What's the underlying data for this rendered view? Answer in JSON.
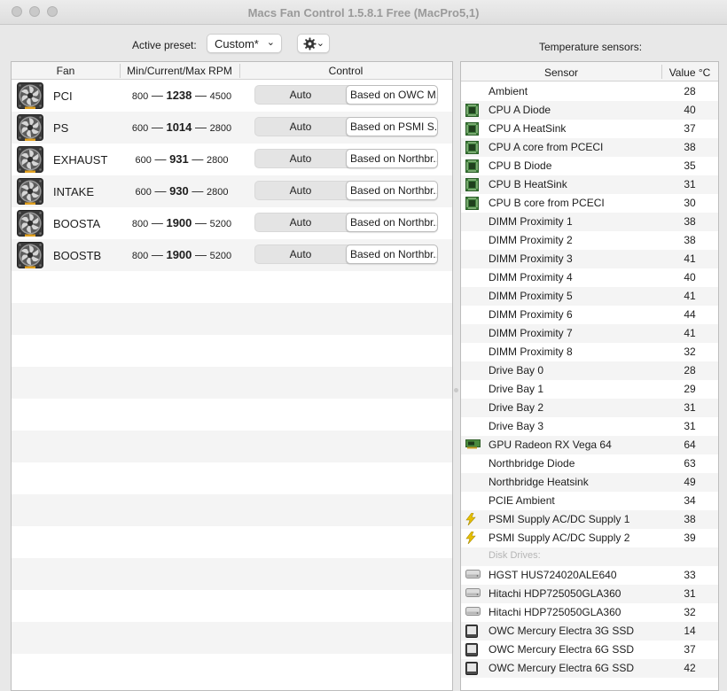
{
  "window": {
    "title": "Macs Fan Control 1.5.8.1 Free (MacPro5,1)"
  },
  "toolbar": {
    "preset_label": "Active preset:",
    "preset_value": "Custom*",
    "settings_icon": "gear-icon"
  },
  "temperature": {
    "title": "Temperature sensors:"
  },
  "fan_table": {
    "headers": {
      "fan": "Fan",
      "rpm": "Min/Current/Max RPM",
      "control": "Control"
    },
    "rows": [
      {
        "name": "PCI",
        "min": "800",
        "current": "1238",
        "max": "4500",
        "mode": "Auto",
        "source": "Based on OWC M..."
      },
      {
        "name": "PS",
        "min": "600",
        "current": "1014",
        "max": "2800",
        "mode": "Auto",
        "source": "Based on PSMI S..."
      },
      {
        "name": "EXHAUST",
        "min": "600",
        "current": "931",
        "max": "2800",
        "mode": "Auto",
        "source": "Based on Northbr..."
      },
      {
        "name": "INTAKE",
        "min": "600",
        "current": "930",
        "max": "2800",
        "mode": "Auto",
        "source": "Based on Northbr..."
      },
      {
        "name": "BOOSTA",
        "min": "800",
        "current": "1900",
        "max": "5200",
        "mode": "Auto",
        "source": "Based on Northbr..."
      },
      {
        "name": "BOOSTB",
        "min": "800",
        "current": "1900",
        "max": "5200",
        "mode": "Auto",
        "source": "Based on Northbr..."
      }
    ]
  },
  "sensor_table": {
    "headers": {
      "sensor": "Sensor",
      "value": "Value °C"
    },
    "rows": [
      {
        "icon": "none",
        "name": "Ambient",
        "value": "28"
      },
      {
        "icon": "cpu-icon",
        "name": "CPU A Diode",
        "value": "40"
      },
      {
        "icon": "cpu-icon",
        "name": "CPU A HeatSink",
        "value": "37"
      },
      {
        "icon": "cpu-icon",
        "name": "CPU A core from PCECI",
        "value": "38"
      },
      {
        "icon": "cpu-icon",
        "name": "CPU B Diode",
        "value": "35"
      },
      {
        "icon": "cpu-icon",
        "name": "CPU B HeatSink",
        "value": "31"
      },
      {
        "icon": "cpu-icon",
        "name": "CPU B core from PCECI",
        "value": "30"
      },
      {
        "icon": "none",
        "name": "DIMM Proximity 1",
        "value": "38"
      },
      {
        "icon": "none",
        "name": "DIMM Proximity 2",
        "value": "38"
      },
      {
        "icon": "none",
        "name": "DIMM Proximity 3",
        "value": "41"
      },
      {
        "icon": "none",
        "name": "DIMM Proximity 4",
        "value": "40"
      },
      {
        "icon": "none",
        "name": "DIMM Proximity 5",
        "value": "41"
      },
      {
        "icon": "none",
        "name": "DIMM Proximity 6",
        "value": "44"
      },
      {
        "icon": "none",
        "name": "DIMM Proximity 7",
        "value": "41"
      },
      {
        "icon": "none",
        "name": "DIMM Proximity 8",
        "value": "32"
      },
      {
        "icon": "none",
        "name": "Drive Bay 0",
        "value": "28"
      },
      {
        "icon": "none",
        "name": "Drive Bay 1",
        "value": "29"
      },
      {
        "icon": "none",
        "name": "Drive Bay 2",
        "value": "31"
      },
      {
        "icon": "none",
        "name": "Drive Bay 3",
        "value": "31"
      },
      {
        "icon": "gpu-icon",
        "name": "GPU Radeon RX Vega 64",
        "value": "64"
      },
      {
        "icon": "none",
        "name": "Northbridge Diode",
        "value": "63"
      },
      {
        "icon": "none",
        "name": "Northbridge Heatsink",
        "value": "49"
      },
      {
        "icon": "none",
        "name": "PCIE Ambient",
        "value": "34"
      },
      {
        "icon": "lightning-icon",
        "name": "PSMI Supply AC/DC Supply 1",
        "value": "38"
      },
      {
        "icon": "lightning-icon",
        "name": "PSMI Supply AC/DC Supply 2",
        "value": "39"
      },
      {
        "icon": "group",
        "name": "Disk Drives:",
        "value": ""
      },
      {
        "icon": "hdd-icon",
        "name": "HGST HUS724020ALE640",
        "value": "33"
      },
      {
        "icon": "hdd-icon",
        "name": "Hitachi HDP725050GLA360",
        "value": "31"
      },
      {
        "icon": "hdd-icon",
        "name": "Hitachi HDP725050GLA360",
        "value": "32"
      },
      {
        "icon": "ssd-icon",
        "name": "OWC Mercury Electra 3G SSD",
        "value": "14"
      },
      {
        "icon": "ssd-icon",
        "name": "OWC Mercury Electra 6G SSD",
        "value": "37"
      },
      {
        "icon": "ssd-icon",
        "name": "OWC Mercury Electra 6G SSD",
        "value": "42"
      }
    ]
  }
}
